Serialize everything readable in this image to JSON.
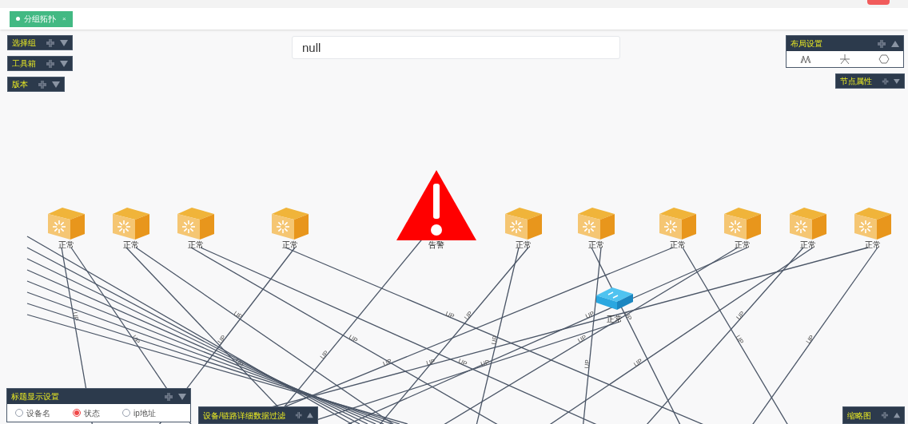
{
  "tabs": [
    {
      "label": "分组拓扑",
      "close": "×",
      "selected": true
    }
  ],
  "search": {
    "value": "null"
  },
  "left_panels": [
    {
      "title": "选择组",
      "expanded": false
    },
    {
      "title": "工具箱",
      "expanded": false
    },
    {
      "title": "版本",
      "expanded": false
    }
  ],
  "layout_panel": {
    "title": "布局设置",
    "expanded": true
  },
  "node_panel": {
    "title": "节点属性",
    "expanded": false
  },
  "nodes": [
    {
      "kind": "server",
      "label": "正常"
    },
    {
      "kind": "server",
      "label": "正常"
    },
    {
      "kind": "server",
      "label": "正常"
    },
    {
      "kind": "server",
      "label": "正常"
    },
    {
      "kind": "alarm",
      "label": "告警"
    },
    {
      "kind": "server",
      "label": "正常"
    },
    {
      "kind": "server",
      "label": "正常"
    },
    {
      "kind": "server",
      "label": "正常"
    },
    {
      "kind": "server",
      "label": "正常"
    },
    {
      "kind": "server",
      "label": "正常"
    },
    {
      "kind": "server",
      "label": "正常"
    },
    {
      "kind": "switch",
      "label": "正常"
    }
  ],
  "links": [
    {
      "label": "UP"
    },
    {
      "label": "UP"
    },
    {
      "label": "UP"
    },
    {
      "label": "UP"
    },
    {
      "label": "UP"
    },
    {
      "label": "UP"
    },
    {
      "label": "UP"
    },
    {
      "label": "UP"
    },
    {
      "label": "UP"
    },
    {
      "label": "UP"
    },
    {
      "label": "UP"
    },
    {
      "label": "UP"
    },
    {
      "label": "UP"
    },
    {
      "label": "UP"
    },
    {
      "label": "UP"
    },
    {
      "label": "UP"
    },
    {
      "label": "UP"
    },
    {
      "label": "UP"
    },
    {
      "label": "UP"
    },
    {
      "label": "UP"
    },
    {
      "label": "UP"
    },
    {
      "label": "UP"
    }
  ],
  "title_panel": {
    "title": "标题显示设置",
    "expanded": false,
    "options": [
      {
        "label": "设备名",
        "selected": false
      },
      {
        "label": "状态",
        "selected": true
      },
      {
        "label": "ip地址",
        "selected": false
      }
    ]
  },
  "filter_panel": {
    "title": "设备/链路详细数据过滤",
    "expanded": true
  },
  "thumbnail_panel": {
    "title": "缩略图",
    "expanded": true
  }
}
